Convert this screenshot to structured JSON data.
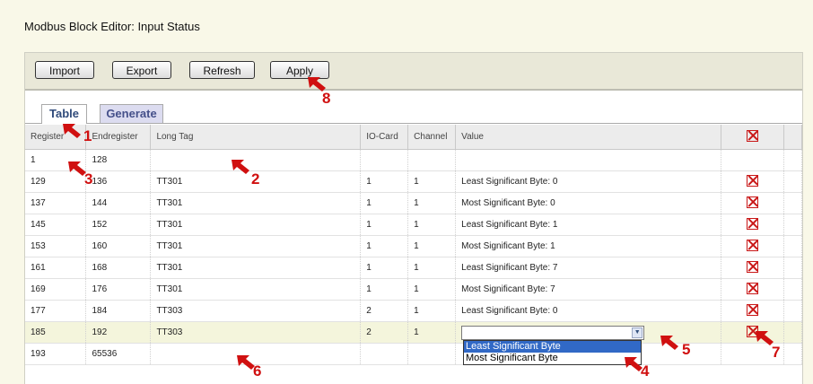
{
  "page": {
    "title": "Modbus Block Editor: Input Status"
  },
  "toolbar": {
    "import_label": "Import",
    "export_label": "Export",
    "refresh_label": "Refresh",
    "apply_label": "Apply"
  },
  "tabs": {
    "table_label": "Table",
    "generate_label": "Generate",
    "active": "Table"
  },
  "grid": {
    "headers": {
      "register": "Register",
      "endregister": "Endregister",
      "long_tag": "Long Tag",
      "io_card": "IO-Card",
      "channel": "Channel",
      "value": "Value"
    },
    "header_delete_icon": "delete-x-icon",
    "rows": [
      {
        "register": "1",
        "endregister": "128",
        "long_tag": "",
        "io_card": "",
        "channel": "",
        "value": ""
      },
      {
        "register": "129",
        "endregister": "136",
        "long_tag": "TT301",
        "io_card": "1",
        "channel": "1",
        "value": "Least Significant Byte: 0"
      },
      {
        "register": "137",
        "endregister": "144",
        "long_tag": "TT301",
        "io_card": "1",
        "channel": "1",
        "value": "Most Significant Byte: 0"
      },
      {
        "register": "145",
        "endregister": "152",
        "long_tag": "TT301",
        "io_card": "1",
        "channel": "1",
        "value": "Least Significant Byte: 1"
      },
      {
        "register": "153",
        "endregister": "160",
        "long_tag": "TT301",
        "io_card": "1",
        "channel": "1",
        "value": "Most Significant Byte: 1"
      },
      {
        "register": "161",
        "endregister": "168",
        "long_tag": "TT301",
        "io_card": "1",
        "channel": "1",
        "value": "Least Significant Byte: 7"
      },
      {
        "register": "169",
        "endregister": "176",
        "long_tag": "TT301",
        "io_card": "1",
        "channel": "1",
        "value": "Most Significant Byte: 7"
      },
      {
        "register": "177",
        "endregister": "184",
        "long_tag": "TT303",
        "io_card": "2",
        "channel": "1",
        "value": "Least Significant Byte: 0"
      },
      {
        "register": "185",
        "endregister": "192",
        "long_tag": "TT303",
        "io_card": "2",
        "channel": "1",
        "value": ""
      },
      {
        "register": "193",
        "endregister": "65536",
        "long_tag": "",
        "io_card": "",
        "channel": "",
        "value": ""
      }
    ]
  },
  "dropdown": {
    "options": [
      "Least Significant Byte",
      "Most Significant Byte"
    ],
    "highlighted": "Least Significant Byte"
  },
  "annotations": {
    "labels": [
      "1",
      "2",
      "3",
      "4",
      "5",
      "6",
      "7",
      "8"
    ],
    "color": "#d01010"
  }
}
